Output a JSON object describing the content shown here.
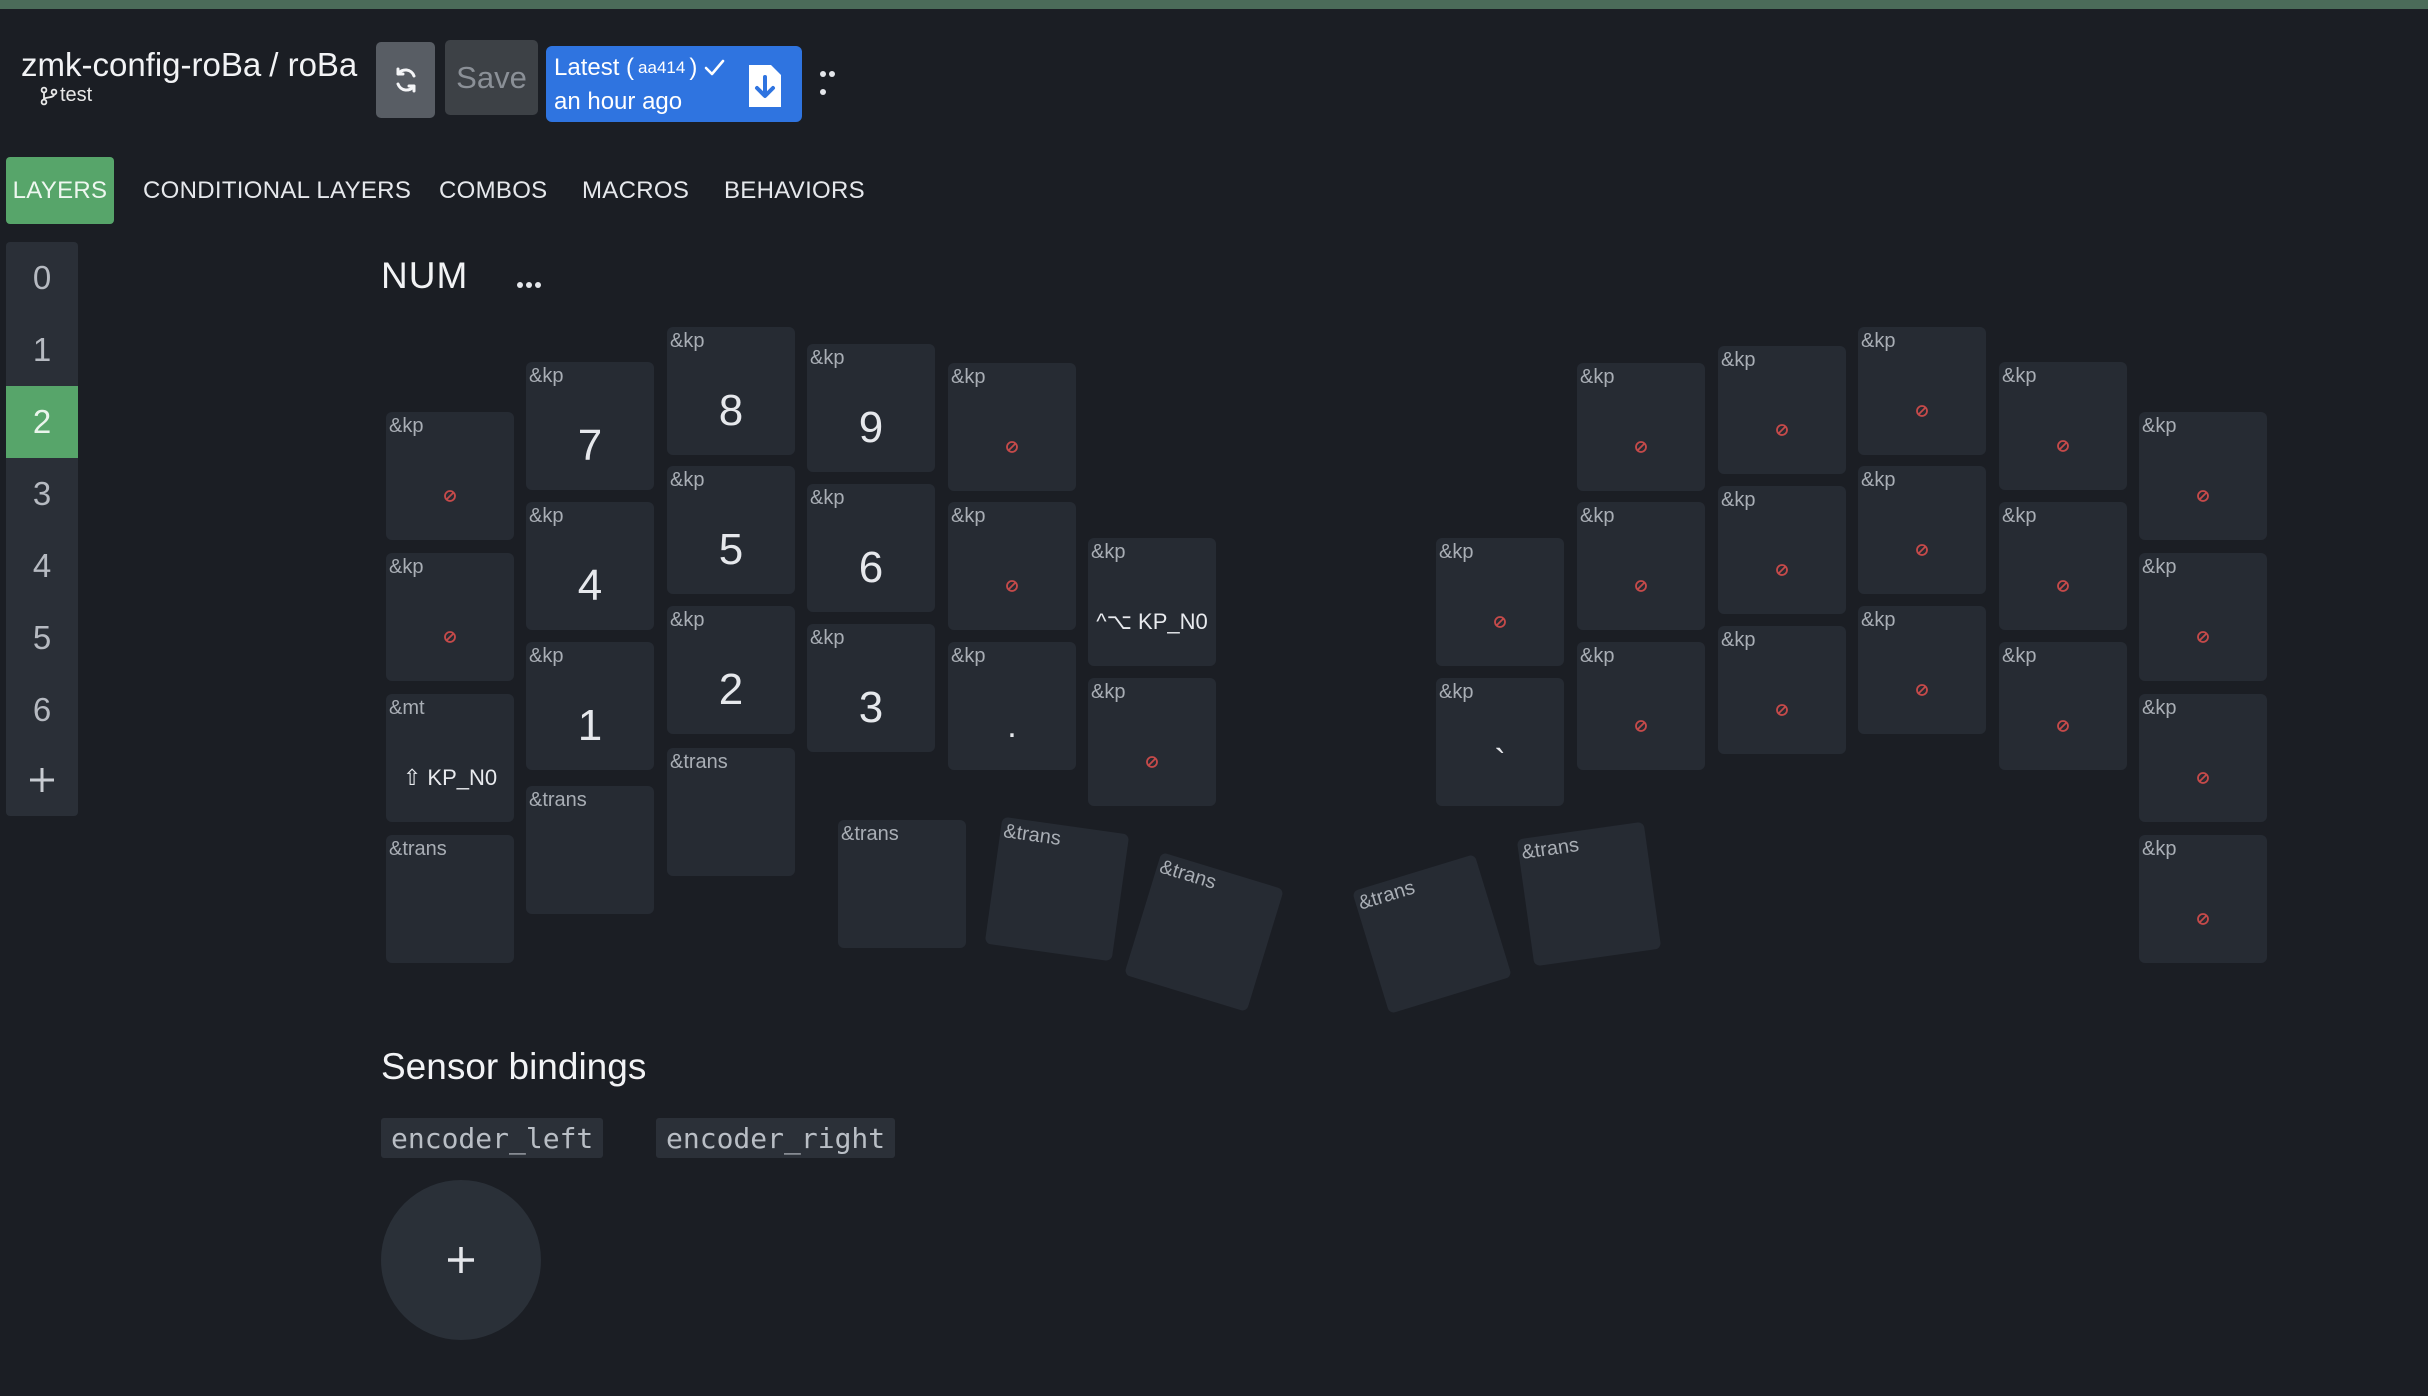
{
  "header": {
    "repo": "zmk-config-roBa",
    "separator": "/",
    "keyboard": "roBa",
    "branch": "test",
    "save_label": "Save",
    "latest_label": "Latest (",
    "latest_hash": "aa414",
    "latest_close": ")",
    "latest_time": "an hour ago"
  },
  "tabs": [
    "LAYERS",
    "CONDITIONAL LAYERS",
    "COMBOS",
    "MACROS",
    "BEHAVIORS"
  ],
  "layers": [
    "0",
    "1",
    "2",
    "3",
    "4",
    "5",
    "6"
  ],
  "active_layer": "2",
  "layer_title": "NUM",
  "keys": [
    {
      "b": "&kp",
      "p": "none"
    },
    {
      "b": "&kp",
      "p": "7"
    },
    {
      "b": "&kp",
      "p": "8"
    },
    {
      "b": "&kp",
      "p": "9"
    },
    {
      "b": "&kp",
      "p": "none"
    },
    {
      "b": "&kp",
      "p": "none"
    },
    {
      "b": "&kp",
      "p": "4"
    },
    {
      "b": "&kp",
      "p": "5"
    },
    {
      "b": "&kp",
      "p": "6"
    },
    {
      "b": "&kp",
      "p": "none"
    },
    {
      "b": "&kp",
      "p": "^⌥ KP_N0"
    },
    {
      "b": "&mt",
      "p": "⇧ KP_N0"
    },
    {
      "b": "&kp",
      "p": "1"
    },
    {
      "b": "&kp",
      "p": "2"
    },
    {
      "b": "&kp",
      "p": "3"
    },
    {
      "b": "&kp",
      "p": "."
    },
    {
      "b": "&kp",
      "p": "none"
    },
    {
      "b": "&trans",
      "p": ""
    },
    {
      "b": "&trans",
      "p": ""
    },
    {
      "b": "&trans",
      "p": ""
    },
    {
      "b": "&trans",
      "p": ""
    },
    {
      "b": "&trans",
      "p": ""
    },
    {
      "b": "&trans",
      "p": ""
    },
    {
      "b": "&trans",
      "p": ""
    },
    {
      "b": "&trans",
      "p": ""
    },
    {
      "b": "&kp",
      "p": "none"
    },
    {
      "b": "&kp",
      "p": "none"
    },
    {
      "b": "&kp",
      "p": "none"
    },
    {
      "b": "&kp",
      "p": "none"
    },
    {
      "b": "&kp",
      "p": "none"
    },
    {
      "b": "&kp",
      "p": "none"
    },
    {
      "b": "&kp",
      "p": "none"
    },
    {
      "b": "&kp",
      "p": "none"
    },
    {
      "b": "&kp",
      "p": "none"
    },
    {
      "b": "&kp",
      "p": "none"
    },
    {
      "b": "&kp",
      "p": "none"
    },
    {
      "b": "&kp",
      "p": "`"
    },
    {
      "b": "&kp",
      "p": "none"
    },
    {
      "b": "&kp",
      "p": "none"
    },
    {
      "b": "&kp",
      "p": "none"
    },
    {
      "b": "&kp",
      "p": "none"
    },
    {
      "b": "&kp",
      "p": "none"
    },
    {
      "b": "&kp",
      "p": "none"
    }
  ],
  "sensor": {
    "title": "Sensor bindings",
    "encoders": [
      "encoder_left",
      "encoder_right"
    ]
  }
}
